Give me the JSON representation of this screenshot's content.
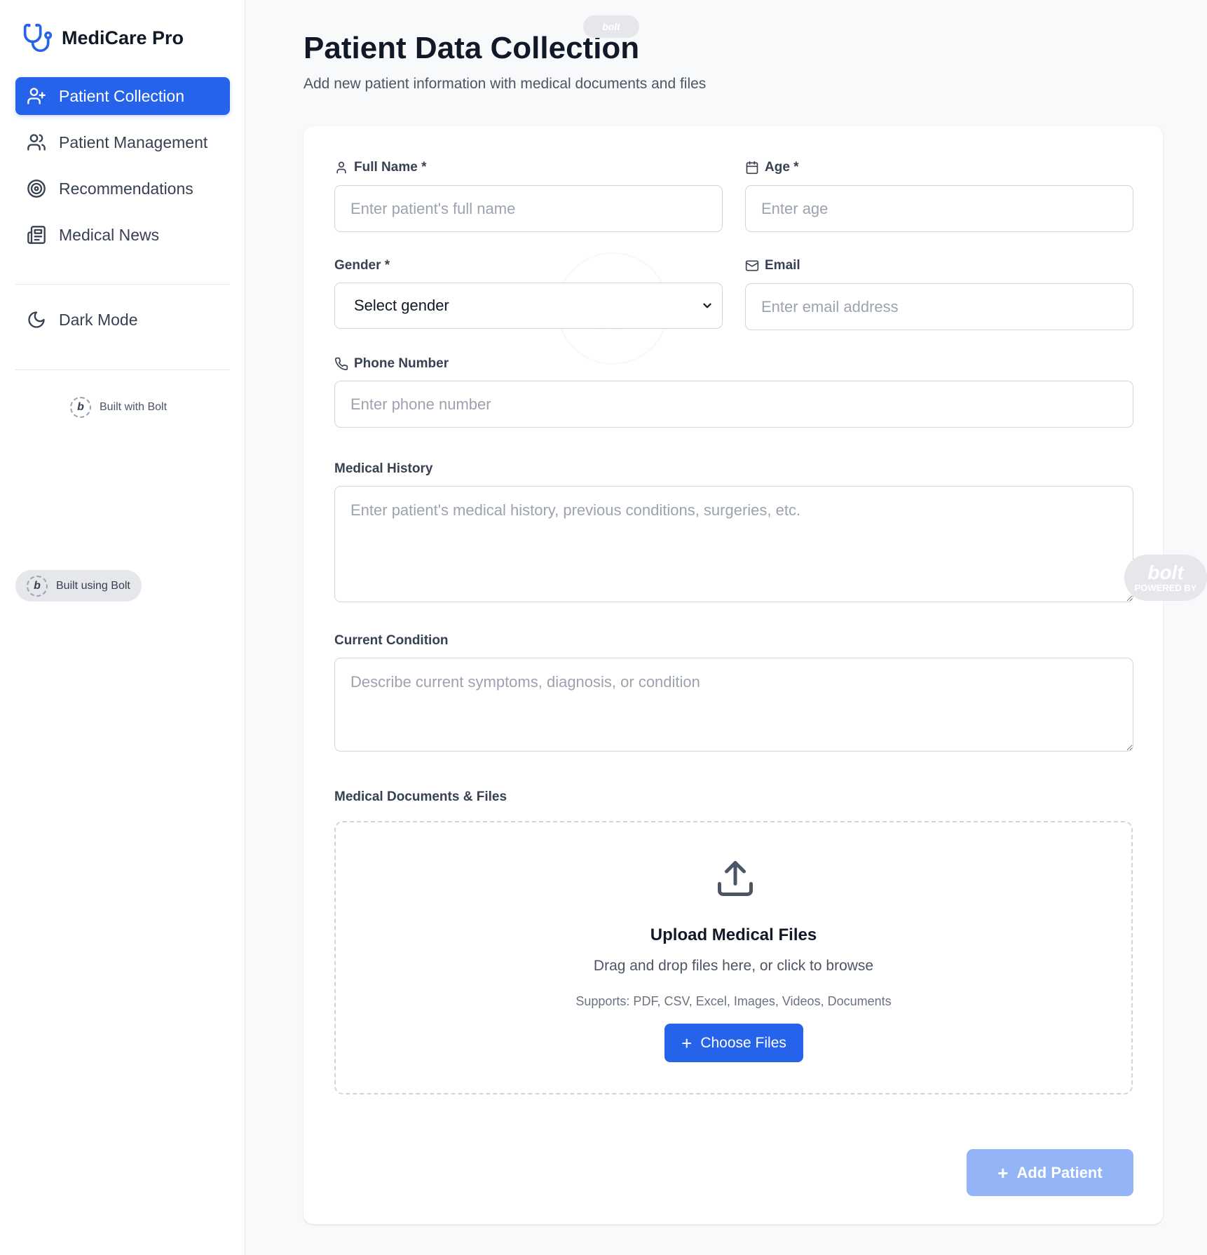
{
  "sidebar": {
    "brand": "MediCare Pro",
    "nav": [
      {
        "label": "Patient Collection",
        "icon": "user-plus-icon",
        "active": true
      },
      {
        "label": "Patient Management",
        "icon": "users-icon",
        "active": false
      },
      {
        "label": "Recommendations",
        "icon": "target-icon",
        "active": false
      },
      {
        "label": "Medical News",
        "icon": "newspaper-icon",
        "active": false
      }
    ],
    "dark_mode": "Dark Mode",
    "built_with": "Built with Bolt",
    "built_using": "Built using Bolt"
  },
  "header": {
    "title": "Patient Data Collection",
    "subtitle": "Add new patient information with medical documents and files"
  },
  "form": {
    "full_name": {
      "label": "Full Name *",
      "placeholder": "Enter patient's full name"
    },
    "age": {
      "label": "Age *",
      "placeholder": "Enter age"
    },
    "gender": {
      "label": "Gender *",
      "value": "Select gender"
    },
    "email": {
      "label": "Email",
      "placeholder": "Enter email address"
    },
    "phone": {
      "label": "Phone Number",
      "placeholder": "Enter phone number"
    },
    "medical_history": {
      "label": "Medical History",
      "placeholder": "Enter patient's medical history, previous conditions, surgeries, etc."
    },
    "current_condition": {
      "label": "Current Condition",
      "placeholder": "Describe current symptoms, diagnosis, or condition"
    },
    "documents_label": "Medical Documents & Files",
    "upload": {
      "title": "Upload Medical Files",
      "description": "Drag and drop files here, or click to browse",
      "supports": "Supports: PDF, CSV, Excel, Images, Videos, Documents",
      "button": "Choose Files"
    },
    "submit": "Add Patient"
  },
  "badges": {
    "bolt_text": "bolt",
    "powered_by": "POWERED BY",
    "bolt_letter": "b"
  },
  "colors": {
    "accent": "#2563eb",
    "accent_disabled": "#93b4f7"
  }
}
